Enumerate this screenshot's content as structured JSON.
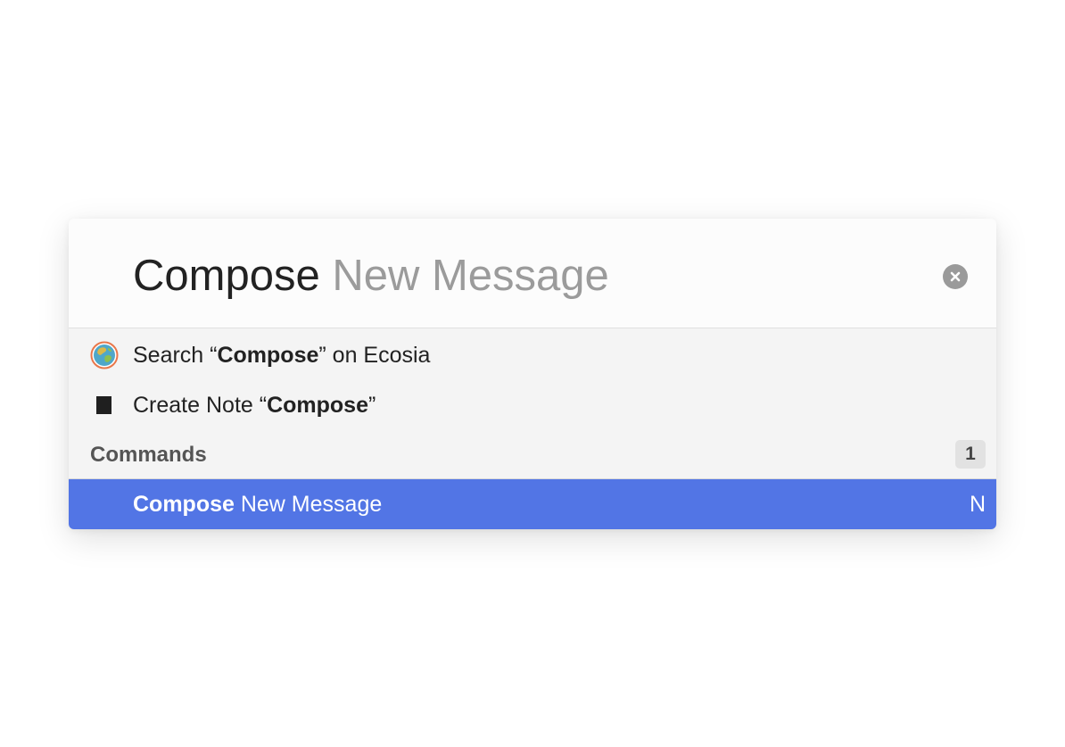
{
  "query": {
    "typed": "Compose",
    "completion": " New Message"
  },
  "results": {
    "search": {
      "prefix": "Search “",
      "keyword": "Compose",
      "suffix": "” on Ecosia",
      "icon": "ecosia-globe-icon"
    },
    "note": {
      "prefix": "Create Note “",
      "keyword": "Compose",
      "suffix": "”",
      "icon": "note-icon"
    }
  },
  "commands_section": {
    "title": "Commands",
    "count": "1"
  },
  "command": {
    "keyword": "Compose",
    "rest": " New Message",
    "shortcut": "N"
  },
  "colors": {
    "accent": "#5275e5",
    "completion_text": "#9b9b9b"
  }
}
